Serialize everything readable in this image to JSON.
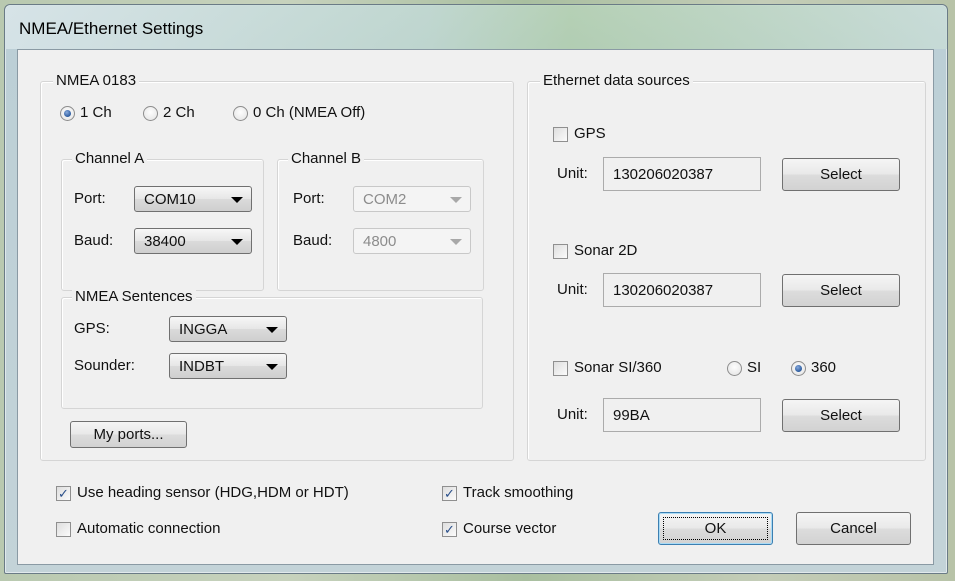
{
  "window": {
    "title": "NMEA/Ethernet Settings"
  },
  "nmea": {
    "group_label": "NMEA 0183",
    "channels": [
      {
        "label": "1 Ch",
        "selected": true
      },
      {
        "label": "2 Ch",
        "selected": false
      },
      {
        "label": "0 Ch (NMEA Off)",
        "selected": false
      }
    ],
    "channel_a": {
      "label": "Channel A",
      "port_label": "Port:",
      "port": "COM10",
      "baud_label": "Baud:",
      "baud": "38400"
    },
    "channel_b": {
      "label": "Channel B",
      "port_label": "Port:",
      "port": "COM2",
      "baud_label": "Baud:",
      "baud": "4800",
      "enabled": false
    },
    "sentences": {
      "label": "NMEA Sentences",
      "gps_label": "GPS:",
      "gps": "INGGA",
      "sounder_label": "Sounder:",
      "sounder": "INDBT"
    },
    "my_ports_label": "My ports..."
  },
  "ethernet": {
    "group_label": "Ethernet data sources",
    "gps": {
      "label": "GPS",
      "checked": false,
      "unit_label": "Unit:",
      "unit": "130206020387",
      "select_label": "Select"
    },
    "sonar2d": {
      "label": "Sonar 2D",
      "checked": false,
      "unit_label": "Unit:",
      "unit": "130206020387",
      "select_label": "Select"
    },
    "sonarsi": {
      "label": "Sonar SI/360",
      "checked": false,
      "si_label": "SI",
      "si_selected": false,
      "deg360_label": "360",
      "deg360_selected": true,
      "unit_label": "Unit:",
      "unit": "99BA",
      "select_label": "Select"
    }
  },
  "options": {
    "heading_sensor": {
      "label": "Use heading sensor (HDG,HDM or HDT)",
      "checked": true
    },
    "auto_connect": {
      "label": "Automatic connection",
      "checked": false
    },
    "track_smoothing": {
      "label": "Track smoothing",
      "checked": true
    },
    "course_vector": {
      "label": "Course vector",
      "checked": true
    }
  },
  "buttons": {
    "ok_label": "OK",
    "cancel_label": "Cancel"
  }
}
